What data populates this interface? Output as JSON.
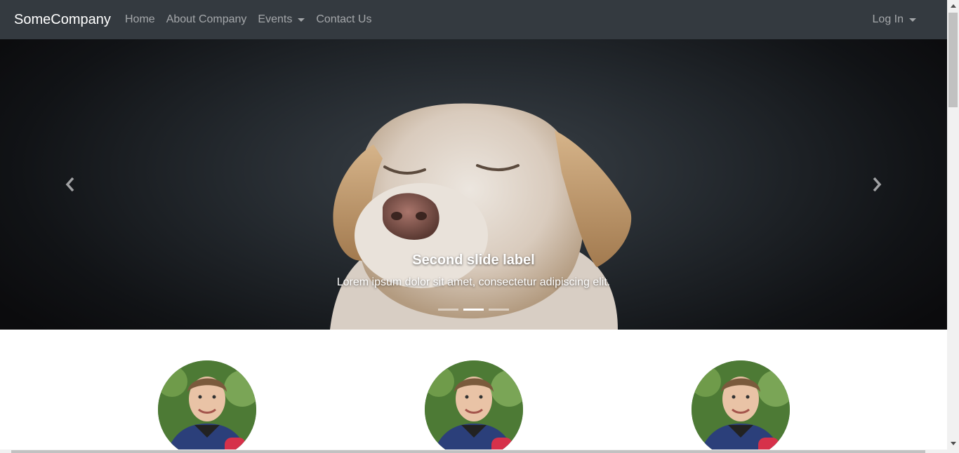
{
  "navbar": {
    "brand": "SomeCompany",
    "links": [
      {
        "label": "Home"
      },
      {
        "label": "About Company"
      },
      {
        "label": "Events"
      },
      {
        "label": "Contact Us"
      }
    ],
    "right_link": "Log In"
  },
  "carousel": {
    "caption_title": "Second slide label",
    "caption_text": "Lorem ipsum dolor sit amet, consectetur adipiscing elit.",
    "indicator_count": 3,
    "active_index": 1
  },
  "avatars_count": 3,
  "colors": {
    "navbar": "#343a40",
    "nav_link": "rgba(255,255,255,0.55)",
    "brand": "#ffffff"
  }
}
